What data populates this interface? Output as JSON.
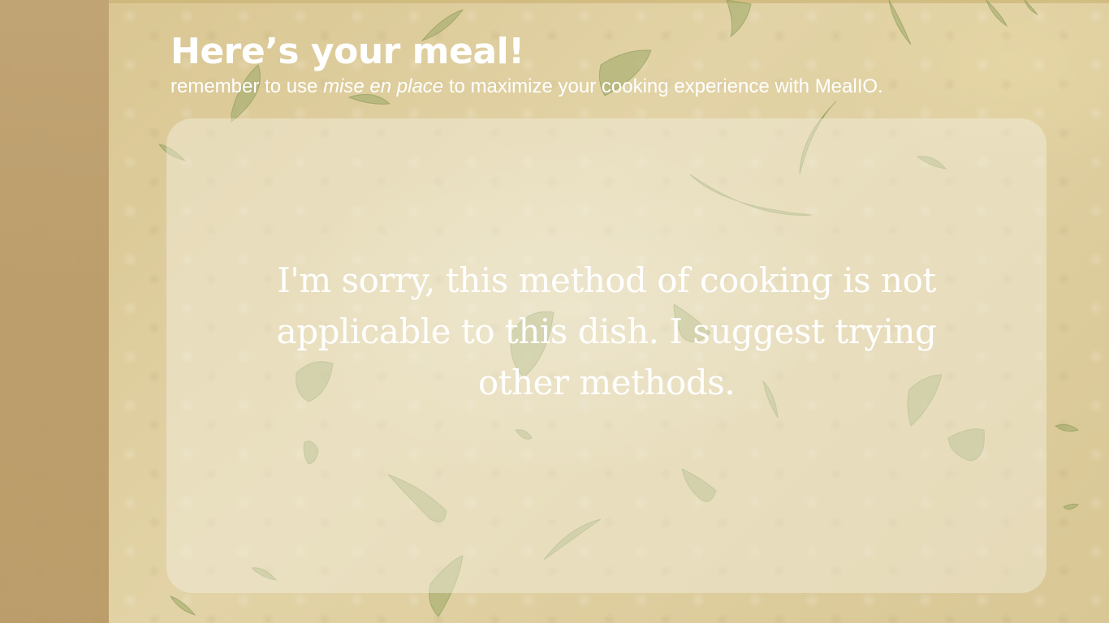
{
  "header": {
    "title": "Here’s your meal!",
    "subtitle_before": "remember to use ",
    "subtitle_emphasis": "mise en place",
    "subtitle_after": " to maximize your cooking experience with MealIO."
  },
  "result": {
    "message": "I'm sorry, this method of cooking is not applicable to this dish. I suggest trying other methods."
  },
  "colors": {
    "background": "#d9c796",
    "side_panel": "#b99a68",
    "card": "#f5f2e6",
    "text": "#ffffff",
    "leaf": "#9aa866"
  }
}
